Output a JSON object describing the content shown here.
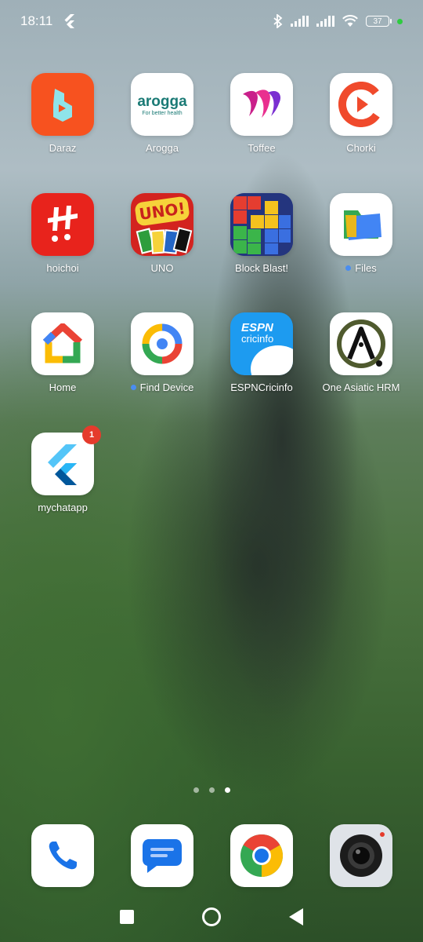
{
  "status": {
    "time": "18:11",
    "battery": "37",
    "icons": [
      "flutter-icon",
      "bluetooth-icon",
      "signal-icon",
      "signal-icon",
      "wifi-icon",
      "battery-icon"
    ]
  },
  "apps": [
    {
      "label": "Daraz",
      "icon": "daraz-icon"
    },
    {
      "label": "Arogga",
      "icon": "arogga-icon",
      "logo_text": "arogga",
      "tagline": "For better health"
    },
    {
      "label": "Toffee",
      "icon": "toffee-icon"
    },
    {
      "label": "Chorki",
      "icon": "chorki-icon"
    },
    {
      "label": "hoichoi",
      "icon": "hoichoi-icon"
    },
    {
      "label": "UNO",
      "icon": "uno-icon",
      "logo_text": "UNO!"
    },
    {
      "label": "Block Blast!",
      "icon": "block-blast-icon"
    },
    {
      "label": "Files",
      "icon": "files-icon",
      "new_dot": true
    },
    {
      "label": "Home",
      "icon": "google-home-icon"
    },
    {
      "label": "Find Device",
      "icon": "find-device-icon",
      "new_dot": true
    },
    {
      "label": "ESPNCricinfo",
      "icon": "espncricinfo-icon",
      "logo_line1": "ESPN",
      "logo_line2": "cricinfo"
    },
    {
      "label": "One Asiatic HRM",
      "icon": "one-asiatic-hrm-icon"
    },
    {
      "label": "mychatapp",
      "icon": "flutter-app-icon",
      "badge": "1"
    }
  ],
  "page_indicator": {
    "count": 3,
    "active": 3
  },
  "dock": [
    {
      "icon": "phone-icon"
    },
    {
      "icon": "messages-icon"
    },
    {
      "icon": "chrome-icon"
    },
    {
      "icon": "camera-icon"
    }
  ],
  "navbar": [
    "recents-button",
    "home-button",
    "back-button"
  ]
}
